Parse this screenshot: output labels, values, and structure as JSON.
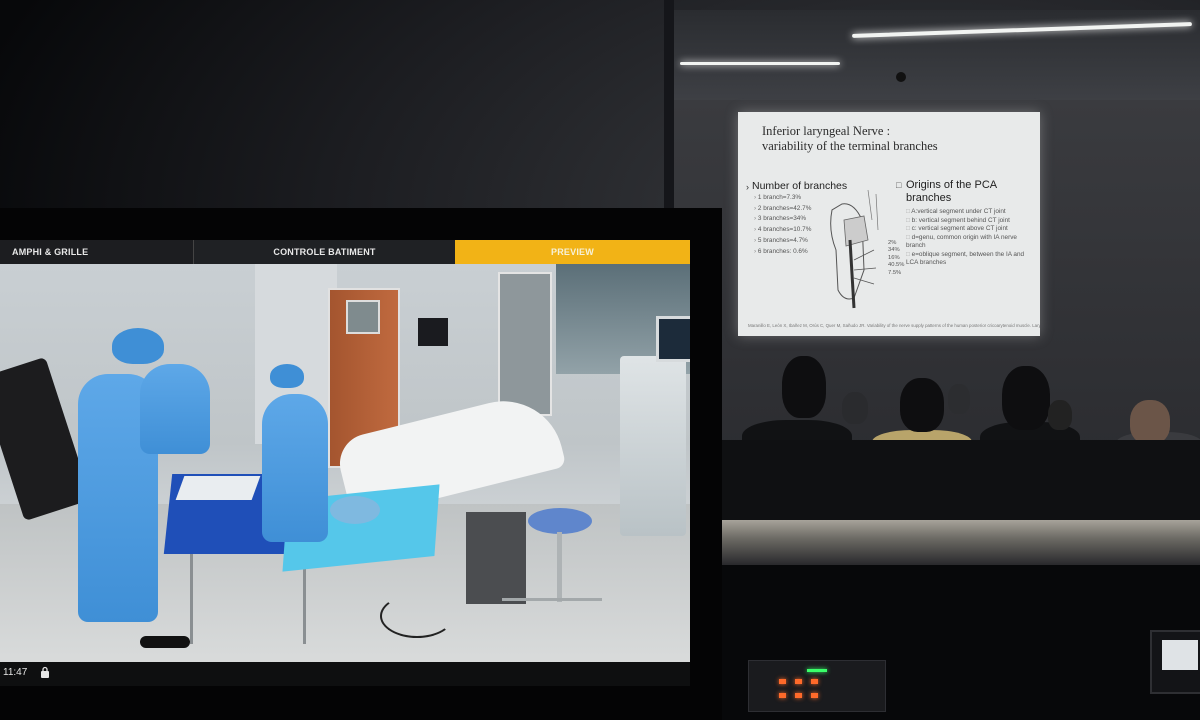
{
  "monitor": {
    "tabs": [
      {
        "label": "AMPHI & GRILLE"
      },
      {
        "label": "CONTROLE BATIMENT"
      },
      {
        "label": "PREVIEW",
        "active": true
      }
    ],
    "status": {
      "time": "11:47",
      "lock_icon": "lock-icon"
    },
    "colors": {
      "tab_active": "#f2b316",
      "tabbar": "#1e2023"
    }
  },
  "slide": {
    "title_line1": "Inferior laryngeal Nerve :",
    "title_line2": "variability of the terminal branches",
    "left_heading": "Number of branches",
    "branches": [
      "1 branch=7.3%",
      "2 branches=42.7%",
      "3 branches=34%",
      "4 branches=10.7%",
      "5 branches=4.7%",
      "6 branches: 0.6%"
    ],
    "right_heading": "Origins of the PCA branches",
    "origins": [
      "A:vertical segment under CT joint",
      "b: vertical segment behind CT joint",
      "c: vertical segment above CT joint",
      "d=genu, common origin with IA nerve branch",
      "e=oblique segment, between the IA and LCA branches"
    ],
    "percentages": [
      "2%",
      "34%",
      "16%",
      "40.5%",
      "7.5%"
    ],
    "reference": "Maranillo E, León X, Ibañez M, Orús C, Quer M, Sañudo JR. Variability of the nerve supply patterns of the human posterior cricoarytenoid muscle. Laryngoscope. 2003 Apr;113(4):602-6."
  }
}
